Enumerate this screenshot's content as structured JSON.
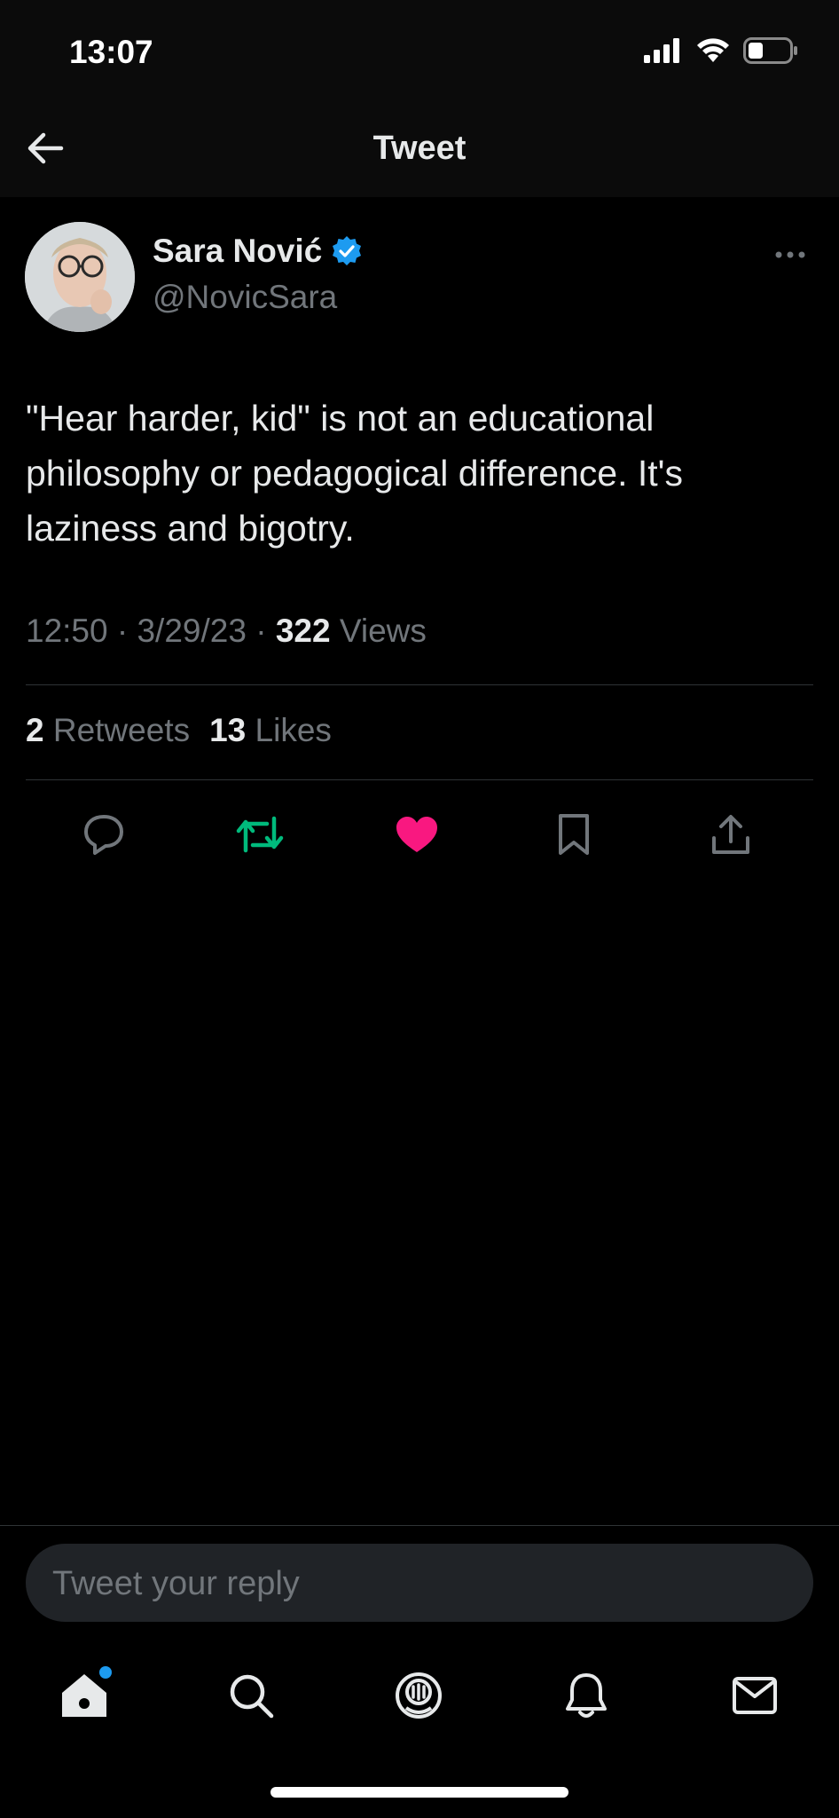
{
  "status": {
    "time": "13:07"
  },
  "nav": {
    "title": "Tweet",
    "back_icon": "arrow-left-icon"
  },
  "tweet": {
    "author": {
      "name": "Sara Nović",
      "handle": "@NovicSara",
      "verified": true
    },
    "text": "\"Hear harder, kid\" is not an educational philosophy or pedagogical difference. It's laziness and bigotry.",
    "time": "12:50",
    "separator": " · ",
    "date": "3/29/23",
    "views_count": "322",
    "views_label": "Views",
    "retweets_count": "2",
    "retweets_label": "Retweets",
    "likes_count": "13",
    "likes_label": "Likes"
  },
  "actions": {
    "icons": [
      "reply-icon",
      "retweet-icon",
      "like-icon",
      "bookmark-icon",
      "share-icon"
    ],
    "retweet_color": "#00ba7c",
    "like_color": "#f91880"
  },
  "reply": {
    "placeholder": "Tweet your reply"
  },
  "tabbar": {
    "icons": [
      "home-icon",
      "search-icon",
      "spaces-icon",
      "notifications-icon",
      "messages-icon"
    ],
    "notification_dot_color": "#1d9bf0"
  }
}
